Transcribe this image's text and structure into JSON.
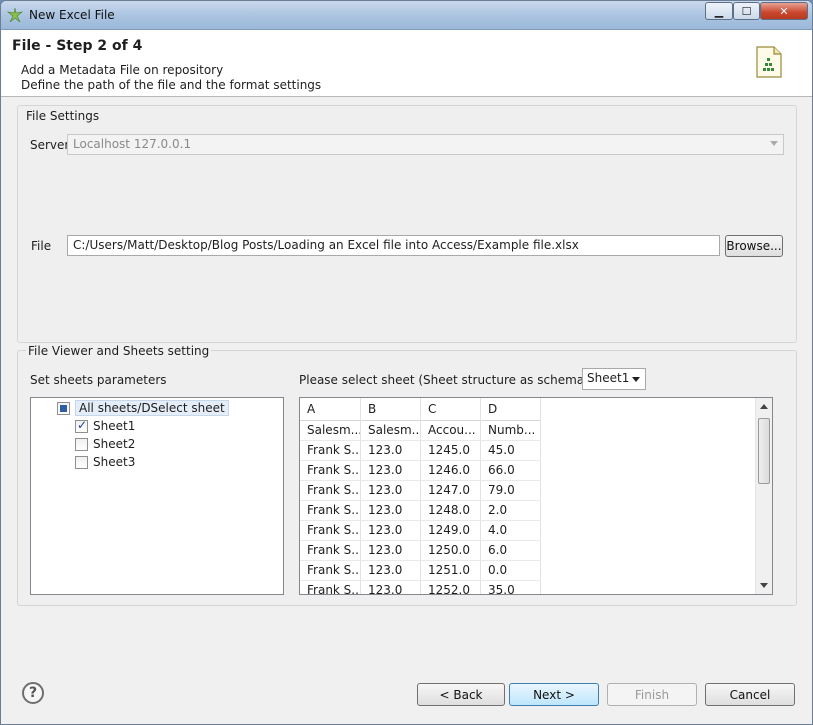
{
  "window": {
    "title": "New Excel File"
  },
  "header": {
    "step_title": "File - Step 2 of 4",
    "desc_line1": "Add a Metadata File on repository",
    "desc_line2": "Define the path of the file and the format settings",
    "icon": "excel-file-icon"
  },
  "file_settings": {
    "label": "File Settings",
    "server_label": "Server",
    "server_value": "Localhost 127.0.0.1",
    "file_label": "File",
    "file_value": "C:/Users/Matt/Desktop/Blog Posts/Loading an Excel file into Access/Example file.xlsx",
    "browse_label": "Browse..."
  },
  "viewer": {
    "label": "File Viewer and Sheets setting",
    "params_label": "Set sheets parameters",
    "select_label": "Please select sheet (Sheet structure as schema guide)",
    "selected_sheet": "Sheet1",
    "tree": {
      "root": "All sheets/DSelect sheet",
      "sheets": [
        {
          "name": "Sheet1",
          "checked": true
        },
        {
          "name": "Sheet2",
          "checked": false
        },
        {
          "name": "Sheet3",
          "checked": false
        }
      ]
    },
    "grid": {
      "columns": [
        "A",
        "B",
        "C",
        "D"
      ],
      "rows": [
        [
          "Salesm...",
          "Salesm...",
          "Accou...",
          "Numb..."
        ],
        [
          "Frank S...",
          "123.0",
          "1245.0",
          "45.0"
        ],
        [
          "Frank S...",
          "123.0",
          "1246.0",
          "66.0"
        ],
        [
          "Frank S...",
          "123.0",
          "1247.0",
          "79.0"
        ],
        [
          "Frank S...",
          "123.0",
          "1248.0",
          "2.0"
        ],
        [
          "Frank S...",
          "123.0",
          "1249.0",
          "4.0"
        ],
        [
          "Frank S...",
          "123.0",
          "1250.0",
          "6.0"
        ],
        [
          "Frank S...",
          "123.0",
          "1251.0",
          "0.0"
        ],
        [
          "Frank S...",
          "123.0",
          "1252.0",
          "35.0"
        ]
      ]
    }
  },
  "footer": {
    "help_glyph": "?",
    "back_label": "< Back",
    "next_label": "Next >",
    "finish_label": "Finish",
    "cancel_label": "Cancel"
  },
  "colors": {
    "accent_default_button": "#3c7fb1",
    "selection": "#e5eef8"
  }
}
